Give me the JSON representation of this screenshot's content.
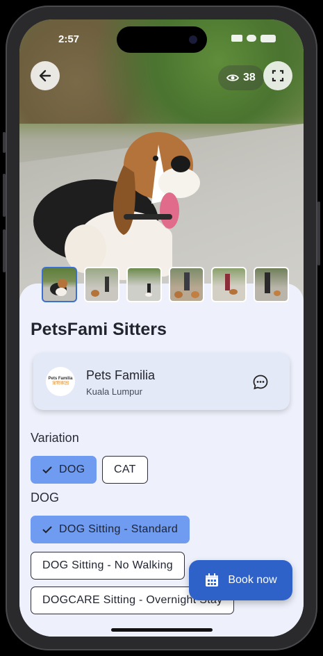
{
  "status_bar": {
    "time": "2:57"
  },
  "hero": {
    "views_count": "38",
    "icons": {
      "back": "arrow-left-icon",
      "views": "eye-icon",
      "fullscreen": "fullscreen-icon"
    }
  },
  "gallery": {
    "thumbnails": [
      {
        "label": "Beagle sitting",
        "selected": true
      },
      {
        "label": "Dog walk 1",
        "selected": false
      },
      {
        "label": "Dog walk 2",
        "selected": false
      },
      {
        "label": "Dog walk 3",
        "selected": false
      },
      {
        "label": "Dog walk 4",
        "selected": false
      },
      {
        "label": "Dog walk 5",
        "selected": false
      }
    ]
  },
  "listing": {
    "title": "PetsFami Sitters"
  },
  "seller": {
    "name": "Pets Familia",
    "location": "Kuala Lumpur",
    "logo_text": "Pets Familia",
    "logo_subtext": "宠物家园",
    "chat_icon": "chat-bubble-icon"
  },
  "variation": {
    "label": "Variation",
    "options": [
      {
        "label": "DOG",
        "selected": true
      },
      {
        "label": "CAT",
        "selected": false
      }
    ]
  },
  "service": {
    "label": "DOG",
    "options": [
      {
        "label": "DOG Sitting - Standard",
        "selected": true
      },
      {
        "label": "DOG Sitting - No Walking",
        "selected": false
      },
      {
        "label": "DOGCARE Sitting - Overnight Stay",
        "selected": false
      }
    ]
  },
  "book_button": {
    "label": "Book now",
    "icon": "calendar-icon"
  },
  "colors": {
    "accent": "#2f62c9",
    "chip_selected": "#6f9bf0",
    "background": "#eef1fb"
  }
}
